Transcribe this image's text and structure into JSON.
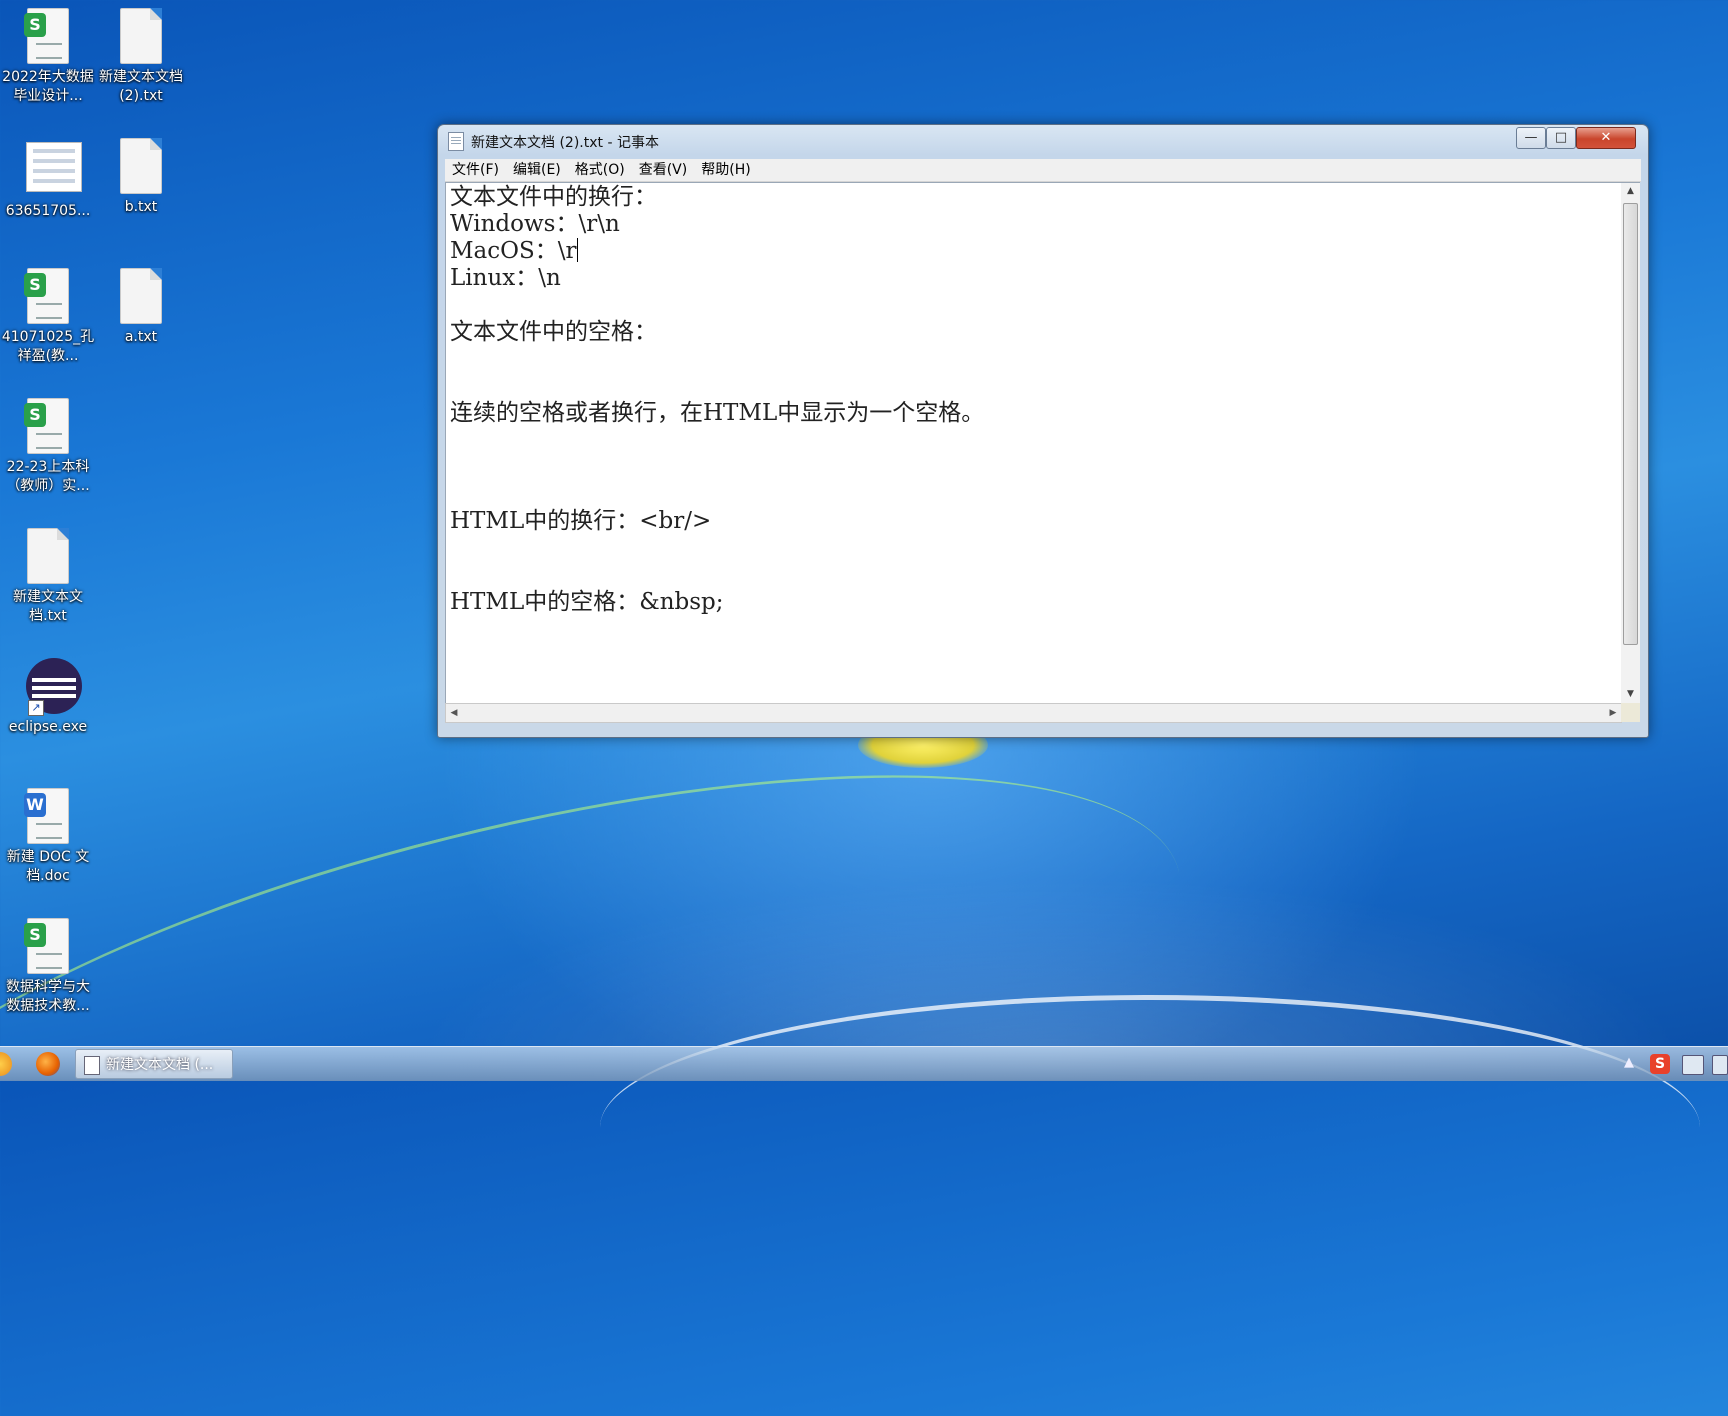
{
  "desktop": {
    "icons": [
      {
        "label": "2022年大数据毕业设计...",
        "icon": "spreadsheet-icon"
      },
      {
        "label": "新建文本文档 (2).txt",
        "icon": "text-file-icon"
      },
      {
        "label": "63651705...",
        "icon": "form-image-icon"
      },
      {
        "label": "b.txt",
        "icon": "text-file-icon"
      },
      {
        "label": "41071025_孔祥盈(教...",
        "icon": "spreadsheet-icon"
      },
      {
        "label": "a.txt",
        "icon": "text-file-icon"
      },
      {
        "label": "22-23上本科（教师）实...",
        "icon": "spreadsheet-icon"
      },
      {
        "label": "新建文本文档.txt",
        "icon": "text-file-icon"
      },
      {
        "label": "eclipse.exe",
        "icon": "eclipse-icon"
      },
      {
        "label": "新建 DOC 文档.doc",
        "icon": "word-doc-icon"
      },
      {
        "label": "数据科学与大数据技术教...",
        "icon": "spreadsheet-icon"
      }
    ]
  },
  "notepad": {
    "title": "新建文本文档 (2).txt - 记事本",
    "window_buttons": {
      "minimize": "—",
      "maximize": "□",
      "close": "✕"
    },
    "menu": [
      "文件(F)",
      "编辑(E)",
      "格式(O)",
      "查看(V)",
      "帮助(H)"
    ],
    "lines": [
      "文本文件中的换行：",
      "Windows：\\r\\n",
      "MacOS：\\r",
      "Linux：\\n",
      "",
      "文本文件中的空格：",
      "",
      "",
      "连续的空格或者换行，在HTML中显示为一个空格。",
      "",
      "",
      "",
      "HTML中的换行：<br/>",
      "",
      "",
      "HTML中的空格：&nbsp;"
    ]
  },
  "taskbar": {
    "task_button_label": "新建文本文档 (...",
    "tray_expand": "▲",
    "colors": {
      "firefox": "#e66000",
      "sogou": "#e8412b"
    }
  }
}
